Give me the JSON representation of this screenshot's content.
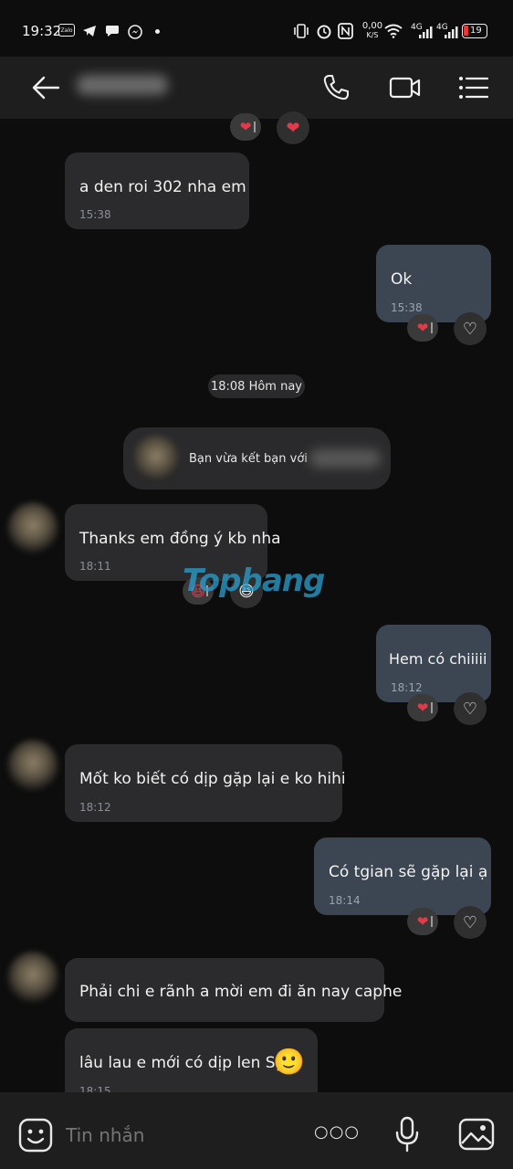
{
  "status_bar": {
    "time": "19:32",
    "app_icons": [
      "zalo-icon",
      "telegram-icon",
      "chat-icon",
      "messenger-icon",
      "dot-icon"
    ],
    "net_speed_value": "0,00",
    "net_speed_unit": "K/S",
    "network_1": "4G",
    "network_2": "4G",
    "battery": "19"
  },
  "header": {
    "back_icon": "arrow-left-icon",
    "call_icon": "phone-icon",
    "video_icon": "video-camera-icon",
    "menu_icon": "list-icon"
  },
  "messages": [
    {
      "dir": "in",
      "text": "a den roi 302 nha em",
      "time": "15:38"
    },
    {
      "dir": "out",
      "text": "Ok",
      "time": "15:38",
      "reaction": "❤"
    },
    {
      "dir": "in",
      "text": "Thanks em đồng ý kb nha",
      "time": "18:11",
      "reaction": "😆"
    },
    {
      "dir": "out",
      "text": "Hem có chiiiii",
      "time": "18:12",
      "reaction": "❤"
    },
    {
      "dir": "in",
      "text": "Mốt ko biết có dịp gặp lại e ko hihi",
      "time": "18:12"
    },
    {
      "dir": "out",
      "text": "Có tgian sẽ gặp lại ạ",
      "time": "18:14",
      "reaction": "❤"
    },
    {
      "dir": "in",
      "text": "Phải chi e rãnh a mời em đi ăn nay caphe"
    },
    {
      "dir": "in",
      "text": "lâu lau e mới có dịp len Sg",
      "time": "18:15",
      "emoji": "🙂"
    }
  ],
  "date_divider": "18:08 Hôm nay",
  "system_notice": "Bạn vừa kết bạn với",
  "watermark": "Topbang",
  "composer": {
    "placeholder": "Tin nhắn",
    "more_label": "○○○"
  },
  "colors": {
    "background": "#0d0d0d",
    "incoming_bubble": "#2b2b2d",
    "outgoing_bubble": "#3c4652",
    "heart": "#e23a4a"
  }
}
